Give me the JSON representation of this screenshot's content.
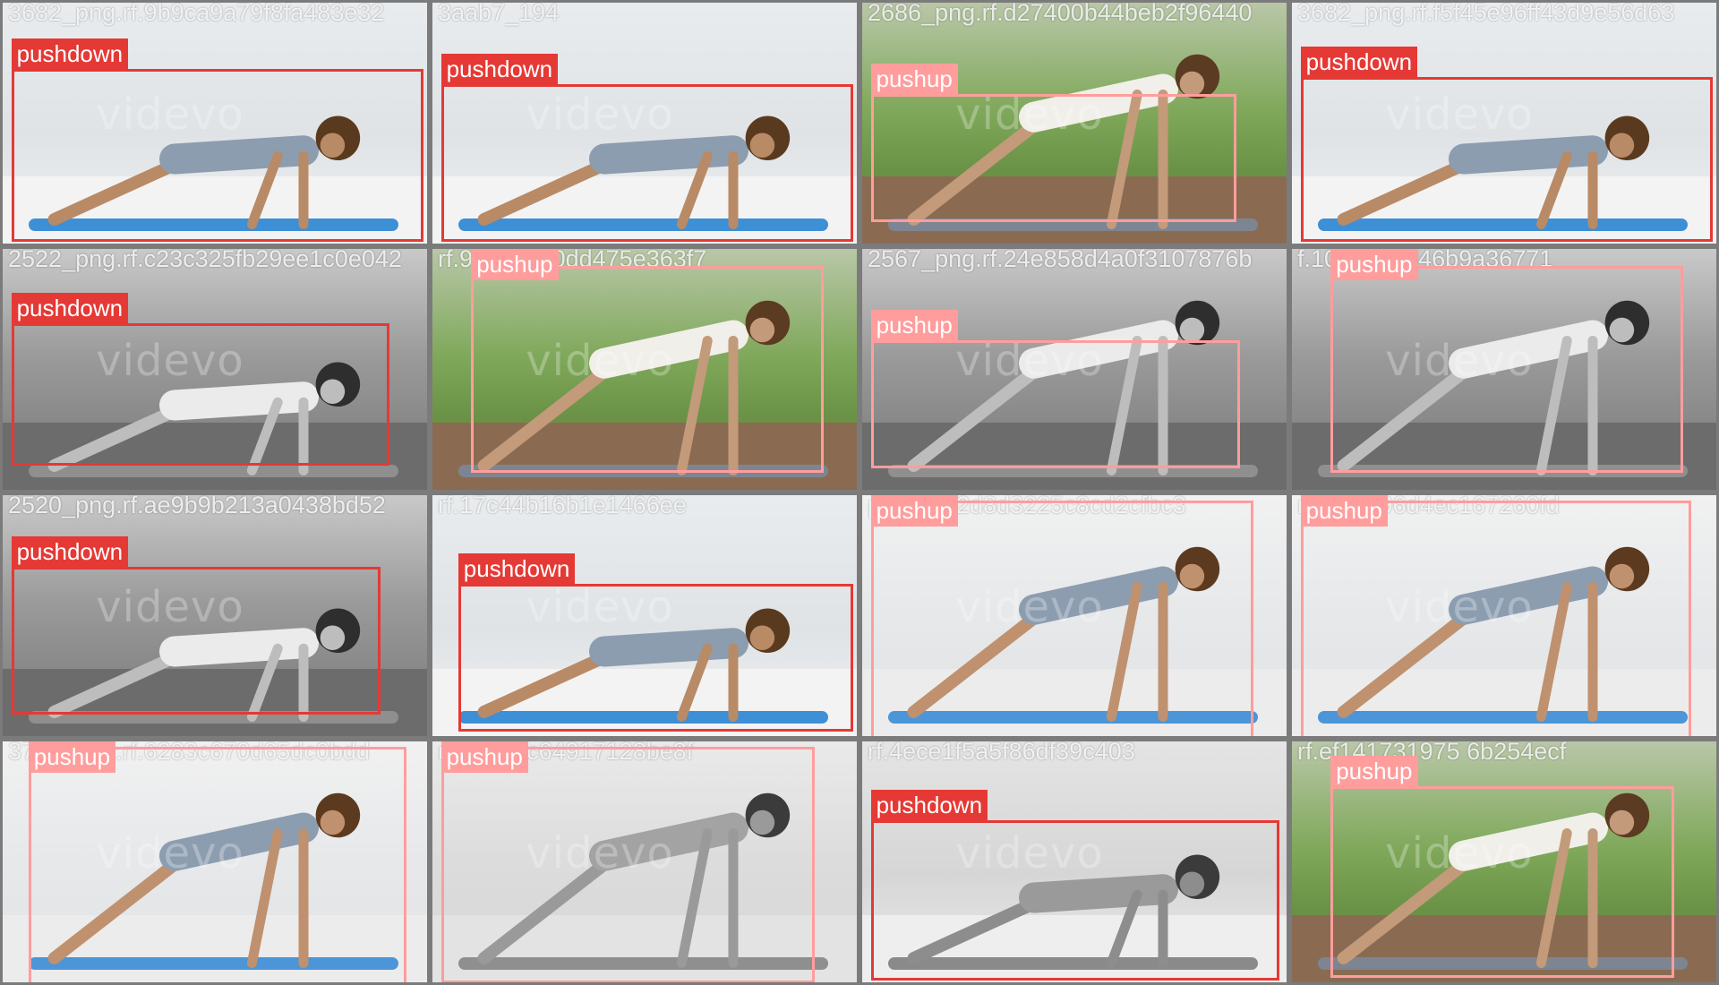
{
  "colors": {
    "pushdown": "#e53935",
    "pushup": "#ff9d9d",
    "pushdown_text": "#ffffff",
    "pushup_text": "#ffffff"
  },
  "tiles": [
    {
      "filename": "3682_png.rf.9b9ca9a79f8fa483e32",
      "label": "pushdown",
      "cls": "pushdown",
      "scene": "kitchen-color"
    },
    {
      "filename": "3aab7_194",
      "label": "pushdown",
      "cls": "pushdown",
      "scene": "kitchen-color"
    },
    {
      "filename": "2686_png.rf.d27400b44beb2f96440",
      "label": "pushup",
      "cls": "pushup",
      "scene": "garden-color"
    },
    {
      "filename": "3682_png.rf.f5f45e96ff43d9e56d63",
      "label": "pushdown",
      "cls": "pushdown",
      "scene": "kitchen-color"
    },
    {
      "filename": "2522_png.rf.c23c325fb29ee1c0e042",
      "label": "pushdown",
      "cls": "pushdown",
      "scene": "garden-gray"
    },
    {
      "filename": "rf.942c2660dd475e363f7",
      "label": "pushup",
      "cls": "pushup",
      "scene": "garden-color"
    },
    {
      "filename": "2567_png.rf.24e858d4a0f3107876b",
      "label": "pushup",
      "cls": "pushup",
      "scene": "garden-gray"
    },
    {
      "filename": "f.102f542bf46b9a36771",
      "label": "pushup",
      "cls": "pushup",
      "scene": "garden-gray"
    },
    {
      "filename": "2520_png.rf.ae9b9b213a0438bd52",
      "label": "pushdown",
      "cls": "pushdown",
      "scene": "garden-gray"
    },
    {
      "filename": "rf.17c44b16b1e1466ee",
      "label": "pushdown",
      "cls": "pushdown",
      "scene": "kitchen-color"
    },
    {
      "filename": "png.rf.f32d8d3225c8cd2cfbc3",
      "label": "pushup",
      "cls": "pushup",
      "scene": "bedroom-color"
    },
    {
      "filename": "rf.b8f6996d4ec167260fd",
      "label": "pushup",
      "cls": "pushup",
      "scene": "bedroom-color"
    },
    {
      "filename": "3761_png.rf.6283c670d65dc0bdd",
      "label": "pushup",
      "cls": "pushup",
      "scene": "bedroom-color"
    },
    {
      "filename": "rf.b1a65c64917128be8f",
      "label": "pushup",
      "cls": "pushup",
      "scene": "bedroom-gray"
    },
    {
      "filename": "rf.4ece1f5a5f86df39c403",
      "label": "pushdown",
      "cls": "pushdown",
      "scene": "kitchen-gray"
    },
    {
      "filename": "rf.ef141731975 6b254ecf",
      "label": "pushup",
      "cls": "pushup",
      "scene": "garden-color"
    }
  ],
  "watermark": "videvo"
}
